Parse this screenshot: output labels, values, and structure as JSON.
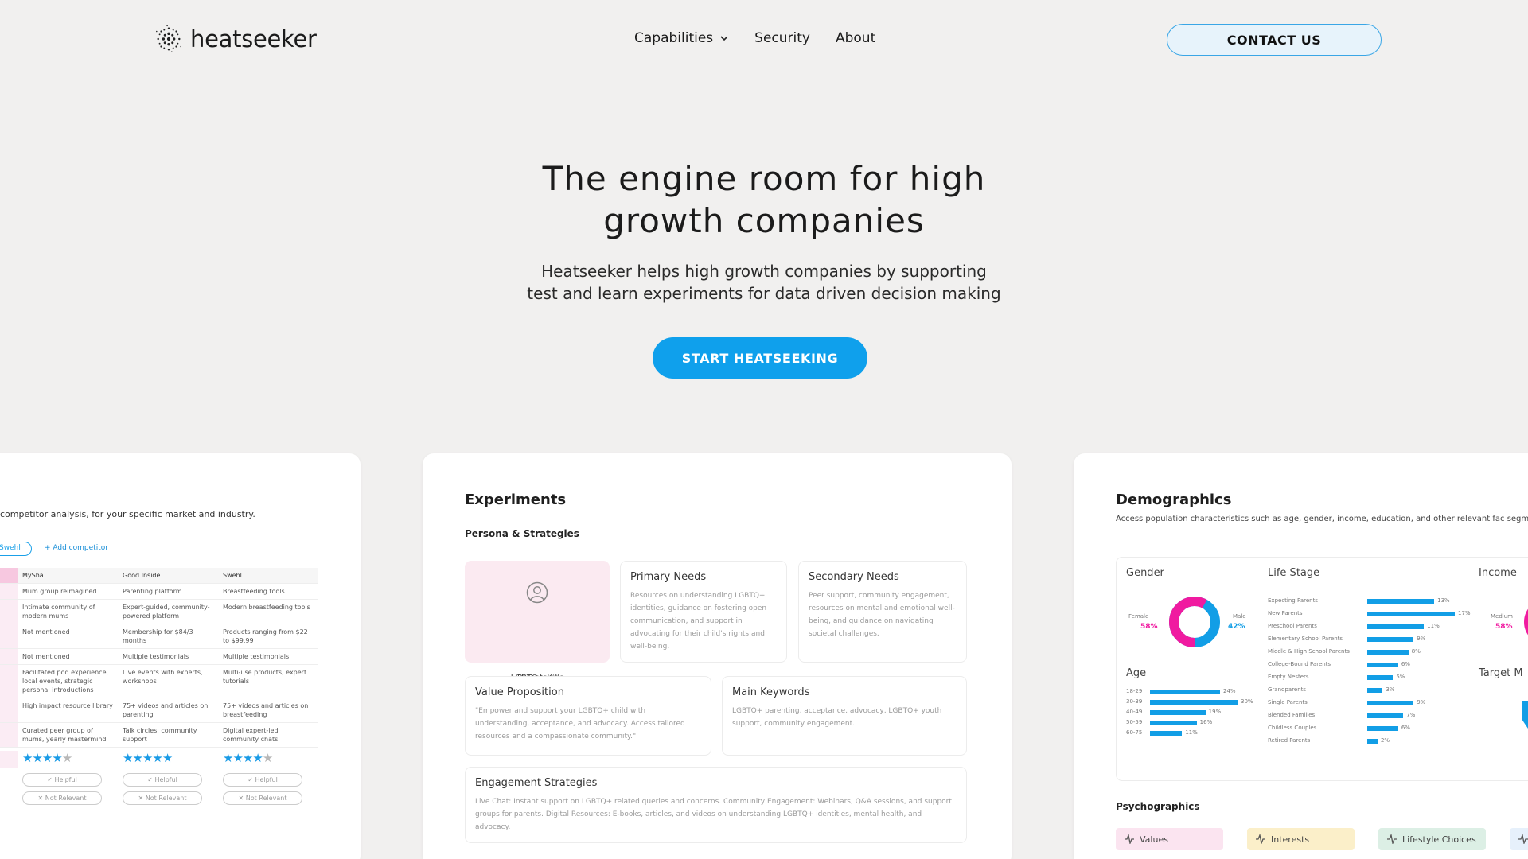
{
  "brand": {
    "name": "heatseeker"
  },
  "nav": {
    "items": [
      {
        "label": "Capabilities",
        "has_dropdown": true
      },
      {
        "label": "Security"
      },
      {
        "label": "About"
      }
    ],
    "contact_label": "CONTACT US"
  },
  "hero": {
    "title_line1": "The engine room for high",
    "title_line2": "growth companies",
    "subtitle_line1": "Heatseeker helps high growth companies by supporting",
    "subtitle_line2": "test and learn experiments for data driven decision making",
    "cta_label": "START HEATSEEKING"
  },
  "competitor_card": {
    "description": "competitor analysis, for your specific market and industry.",
    "selected_pill": "Swehl",
    "add_label": "+ Add competitor",
    "columns": [
      "MySha",
      "Good Inside",
      "Swehl"
    ],
    "rows": [
      [
        "Mum group reimagined",
        "Parenting platform",
        "Breastfeeding tools"
      ],
      [
        "Intimate community of modern mums",
        "Expert-guided, community-powered platform",
        "Modern breastfeeding tools"
      ],
      [
        "Not mentioned",
        "Membership for $84/3 months",
        "Products ranging from $22 to $99.99"
      ],
      [
        "Not mentioned",
        "Multiple testimonials",
        "Multiple testimonials"
      ],
      [
        "Facilitated pod experience, local events, strategic personal introductions",
        "Live events with experts, workshops",
        "Multi-use products, expert tutorials"
      ],
      [
        "High impact resource library",
        "75+ videos and articles on parenting",
        "75+ videos and articles on breastfeeding"
      ],
      [
        "Curated peer group of mums, yearly mastermind",
        "Talk circles, community support",
        "Digital expert-led community chats"
      ]
    ],
    "first_col_fragments": [
      "",
      "",
      "",
      "",
      "er",
      "",
      "nt"
    ],
    "ratings": [
      4,
      5,
      4
    ],
    "helpful_label": "Helpful",
    "not_relevant_label": "Not Relevant"
  },
  "experiments_card": {
    "title": "Experiments",
    "section": "Persona & Strategies",
    "persona_line1": "Parents of",
    "persona_line2": "LGBTQ+ Kids",
    "primary_needs": {
      "title": "Primary Needs",
      "body": "Resources on understanding LGBTQ+ identities, guidance on fostering open communication, and support in advocating for their child's rights and well-being."
    },
    "secondary_needs": {
      "title": "Secondary Needs",
      "body": "Peer support, community engagement, resources on mental and emotional well-being, and guidance on navigating societal challenges."
    },
    "value_proposition": {
      "title": "Value Proposition",
      "body": "\"Empower and support your LGBTQ+ child with understanding, acceptance, and advocacy. Access tailored resources and a compassionate community.\""
    },
    "main_keywords": {
      "title": "Main Keywords",
      "body": "LGBTQ+ parenting, acceptance, advocacy, LGBTQ+ youth support, community engagement."
    },
    "engagement": {
      "title": "Engagement Strategies",
      "body": "Live Chat: Instant support on LGBTQ+ related queries and concerns. Community Engagement: Webinars, Q&A sessions, and support groups for parents. Digital Resources: E-books, articles, and videos on understanding LGBTQ+ identities, mental health, and advocacy."
    }
  },
  "demographics_card": {
    "title": "Demographics",
    "description": "Access population characteristics such as age, gender, income, education, and other relevant fac segment",
    "gender": {
      "heading": "Gender",
      "female_label": "Female",
      "female_pct": "58%",
      "male_label": "Male",
      "male_pct": "42%",
      "female_share": 0.58
    },
    "age": {
      "heading": "Age",
      "labels": [
        "18-29",
        "30-39",
        "40-49",
        "50-59",
        "60-75"
      ],
      "values": [
        24,
        30,
        19,
        16,
        11
      ],
      "pct_labels": [
        "24%",
        "30%",
        "19%",
        "16%",
        "11%"
      ]
    },
    "life_stage": {
      "heading": "Life Stage",
      "labels": [
        "Expecting Parents",
        "New Parents",
        "Preschool Parents",
        "Elementary School Parents",
        "Middle & High School Parents",
        "College-Bound Parents",
        "Empty Nesters",
        "Grandparents",
        "Single Parents",
        "Blended Families",
        "Childless Couples",
        "Retired Parents"
      ],
      "values": [
        13,
        17,
        11,
        9,
        8,
        6,
        5,
        3,
        9,
        7,
        6,
        2
      ],
      "pct_labels": [
        "13%",
        "17%",
        "11%",
        "9%",
        "8%",
        "6%",
        "5%",
        "3%",
        "9%",
        "7%",
        "6%",
        "2%"
      ]
    },
    "income": {
      "heading": "Income",
      "label": "Medium",
      "pct": "58%"
    },
    "target": {
      "heading": "Target M"
    },
    "psychographics": {
      "heading": "Psychographics",
      "chips": [
        "Values",
        "Interests",
        "Lifestyle Choices"
      ]
    },
    "colors": {
      "bar": "#129ee6",
      "female": "#f01aa0",
      "male": "#129ee6"
    }
  }
}
